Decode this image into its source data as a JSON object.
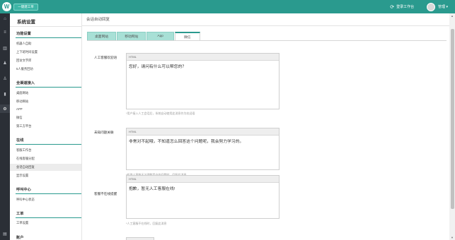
{
  "topbar": {
    "logo": "W",
    "main_button": "一键建工单",
    "workbench_label": "登录工作台",
    "username": "管理",
    "user_caret": "▾"
  },
  "rail": {
    "icons": [
      "home-icon",
      "list-icon",
      "library-icon",
      "user-icon",
      "profile-icon",
      "chart-icon",
      "settings-icon",
      "chat-icon"
    ],
    "glyphs": [
      "⌂",
      "≡",
      "▥",
      "♟",
      "♙",
      "▮",
      "⚙",
      "▤"
    ]
  },
  "nav": {
    "title": "系统设置",
    "groups": [
      {
        "label": "功能设置",
        "items": [
          "机器人自助",
          "上下班时间设置",
          "回访文字库",
          "5人服务回访"
        ]
      },
      {
        "label": "全渠道接入",
        "items": [
          "桌面网站",
          "移动网站",
          "APP",
          "微信",
          "第三方平台"
        ]
      },
      {
        "label": "在线",
        "items": [
          "客服工作台",
          "在线客服分配",
          "会话自动回复",
          "显示设置"
        ]
      },
      {
        "label": "呼叫中心",
        "items": [
          "呼叫中心状态"
        ]
      },
      {
        "label": "工单",
        "items": [
          "工单设置"
        ]
      },
      {
        "label": "账户",
        "items": []
      }
    ]
  },
  "main": {
    "title": "会话自动回复",
    "tabs": [
      "桌面网站",
      "移动网站",
      "App",
      "微信"
    ],
    "sections": [
      {
        "label": "人工客服欢迎语",
        "toolbar": "HTML",
        "content": "您好，请问有什么可以帮您的？",
        "hint": "*用户接入人工会话后，系统自动使用此消息作为欢迎语"
      },
      {
        "label": "未知问题关联",
        "toolbar": "HTML",
        "content": "非常对不起哦，不知道怎么回答这个问题呢，我会努力学习的。",
        "hint": "*机器人客服无法理解用户的问题时，回复此消息"
      },
      {
        "label": "客服不在线提醒",
        "toolbar": "HTML",
        "content": "抱歉，暂无人工客服在线!",
        "hint": "*人工客服不在线时，回复此消息"
      }
    ]
  },
  "colors": {
    "brand": "#2a9a8e",
    "tab_inactive": "#a8e0d6",
    "rail": "#2b2f36"
  }
}
